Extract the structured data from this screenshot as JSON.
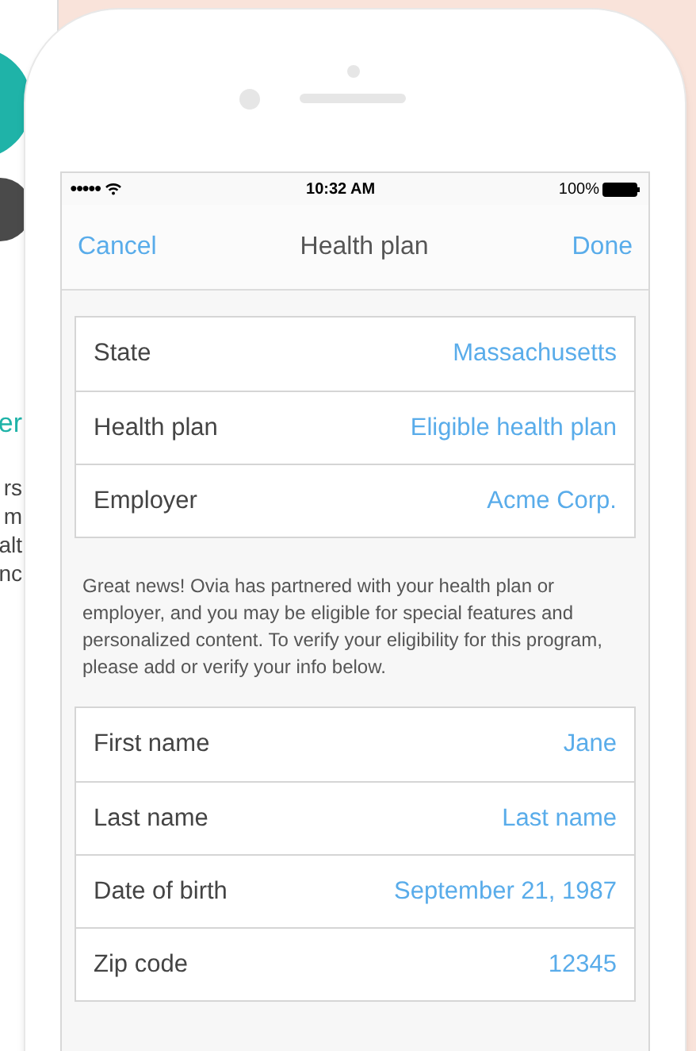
{
  "background_page": {
    "heading": "er",
    "lines": [
      "rs",
      "m",
      "alt",
      "nc"
    ]
  },
  "status_bar": {
    "signal_dots": "●●●●●",
    "time": "10:32 AM",
    "battery": "100%"
  },
  "nav_bar": {
    "left_button": "Cancel",
    "title": "Health plan",
    "right_button": "Done"
  },
  "plan_fields": [
    {
      "label": "State",
      "value": "Massachusetts"
    },
    {
      "label": "Health plan",
      "value": "Eligible health plan"
    },
    {
      "label": "Employer",
      "value": "Acme Corp."
    }
  ],
  "notice": "Great news! Ovia has partnered with your health plan or employer, and you may be eligible for special features and personalized content. To verify your eligibility for this program, please add or verify your info below.",
  "personal_fields": [
    {
      "label": "First name",
      "value": "Jane"
    },
    {
      "label": "Last name",
      "placeholder": "Last name"
    },
    {
      "label": "Date of birth",
      "value": "September 21, 1987"
    },
    {
      "label": "Zip code",
      "value": "12345"
    }
  ]
}
